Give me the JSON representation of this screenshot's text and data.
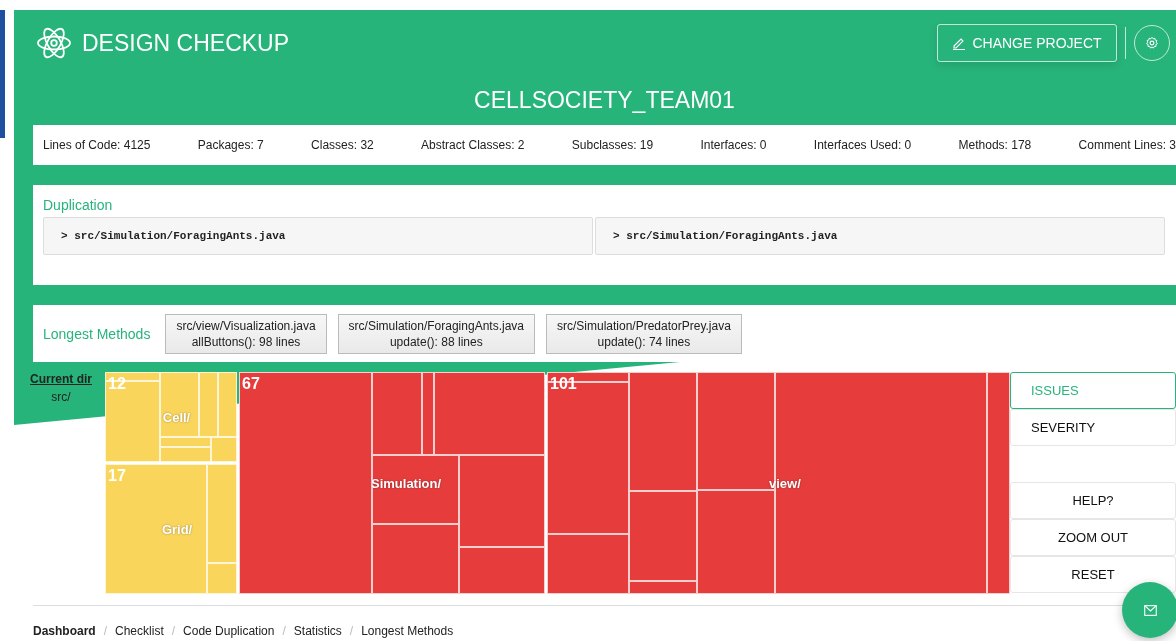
{
  "app": {
    "title": "DESIGN CHECKUP",
    "change_project": "CHANGE PROJECT"
  },
  "project": {
    "title": "CELLSOCIETY_TEAM01"
  },
  "stats": [
    "Lines of Code: 4125",
    "Packages: 7",
    "Classes: 32",
    "Abstract Classes: 2",
    "Subclasses: 19",
    "Interfaces: 0",
    "Interfaces Used: 0",
    "Methods: 178",
    "Comment Lines: 3"
  ],
  "duplication": {
    "title": "Duplication",
    "items": [
      "> src/Simulation/ForagingAnts.java",
      "> src/Simulation/ForagingAnts.java"
    ]
  },
  "longest_methods": {
    "title": "Longest Methods",
    "items": [
      {
        "file": "src/view/Visualization.java",
        "method": "allButtons(): 98 lines"
      },
      {
        "file": "src/Simulation/ForagingAnts.java",
        "method": "update(): 88 lines"
      },
      {
        "file": "src/Simulation/PredatorPrey.java",
        "method": "update(): 74 lines"
      }
    ]
  },
  "current_dir": {
    "label": "Current dir",
    "path": "src/"
  },
  "treemap": {
    "packages": [
      {
        "name": "Cell/",
        "count": "12",
        "color": "#fad55c"
      },
      {
        "name": "Grid/",
        "count": "17",
        "color": "#fad55c"
      },
      {
        "name": "Simulation/",
        "count": "67",
        "color": "#e73c3c"
      },
      {
        "name": "view/",
        "count": "101",
        "color": "#e73c3c"
      }
    ]
  },
  "view_options": [
    {
      "label": "ISSUES",
      "selected": true
    },
    {
      "label": "SEVERITY",
      "selected": false
    }
  ],
  "actions": [
    "HELP?",
    "ZOOM OUT",
    "RESET"
  ],
  "breadcrumb": [
    {
      "label": "Dashboard",
      "selected": true
    },
    {
      "label": "Checklist",
      "selected": false,
      "separator": "/"
    },
    {
      "label": "Code Duplication",
      "selected": false,
      "separator": "/"
    },
    {
      "label": "Statistics",
      "selected": false,
      "separator": "/"
    },
    {
      "label": "Longest Methods",
      "selected": false,
      "separator": "/"
    }
  ]
}
